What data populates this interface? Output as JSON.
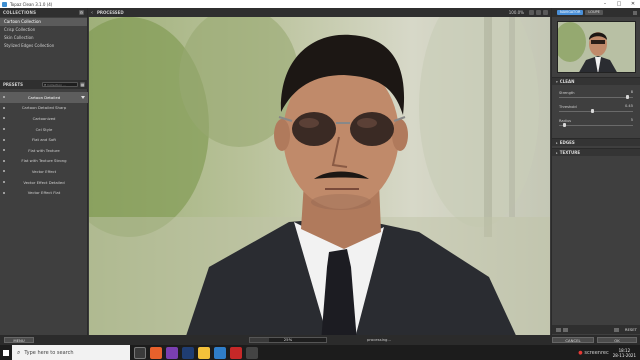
{
  "window": {
    "title": "Topaz Clean 3.1.0 (4)"
  },
  "collections": {
    "header": "COLLECTIONS",
    "items": [
      {
        "label": "Cartoon Collection",
        "selected": true
      },
      {
        "label": "Crisp Collection",
        "selected": false
      },
      {
        "label": "Skin Collection",
        "selected": false
      },
      {
        "label": "Stylized Edges Collection",
        "selected": false
      }
    ]
  },
  "presets": {
    "header": "PRESETS",
    "search_placeholder": "Collection ...",
    "items": [
      {
        "label": "Cartoon Detailed",
        "selected": true
      },
      {
        "label": "Cartoon Detailed Sharp",
        "selected": false
      },
      {
        "label": "Cartoonized",
        "selected": false
      },
      {
        "label": "Cel Style",
        "selected": false
      },
      {
        "label": "Flat and Soft",
        "selected": false
      },
      {
        "label": "Flat with Texture",
        "selected": false
      },
      {
        "label": "Flat with Texture Strong",
        "selected": false
      },
      {
        "label": "Vector Effect",
        "selected": false
      },
      {
        "label": "Vector Effect Detailed",
        "selected": false
      },
      {
        "label": "Vector Effect Flat",
        "selected": false
      }
    ]
  },
  "preview": {
    "header": "PROCESSED",
    "zoom": "100.0%"
  },
  "navigator": {
    "tabs": [
      "NAVIGATOR",
      "LOUPE"
    ],
    "active_tab": "NAVIGATOR"
  },
  "clean": {
    "header": "CLEAN",
    "sliders": [
      {
        "label": "Strength",
        "value": "8",
        "level": 0.95
      },
      {
        "label": "Threshold",
        "value": "0.45",
        "level": 0.45
      },
      {
        "label": "Radius",
        "value": "5",
        "level": 0.05
      }
    ]
  },
  "edges": {
    "header": "EDGES"
  },
  "texture": {
    "header": "TEXTURE"
  },
  "bottom_right": {
    "reset": "RESET"
  },
  "status": {
    "menu": "MENU",
    "progress_text": "25%",
    "progress": 0.25,
    "processing": "processing...",
    "cancel": "CANCEL",
    "ok": "OK"
  },
  "taskbar": {
    "search_placeholder": "Type here to search",
    "screenrec": "screenrec",
    "time": "18:12",
    "date": "28-11-2021"
  }
}
